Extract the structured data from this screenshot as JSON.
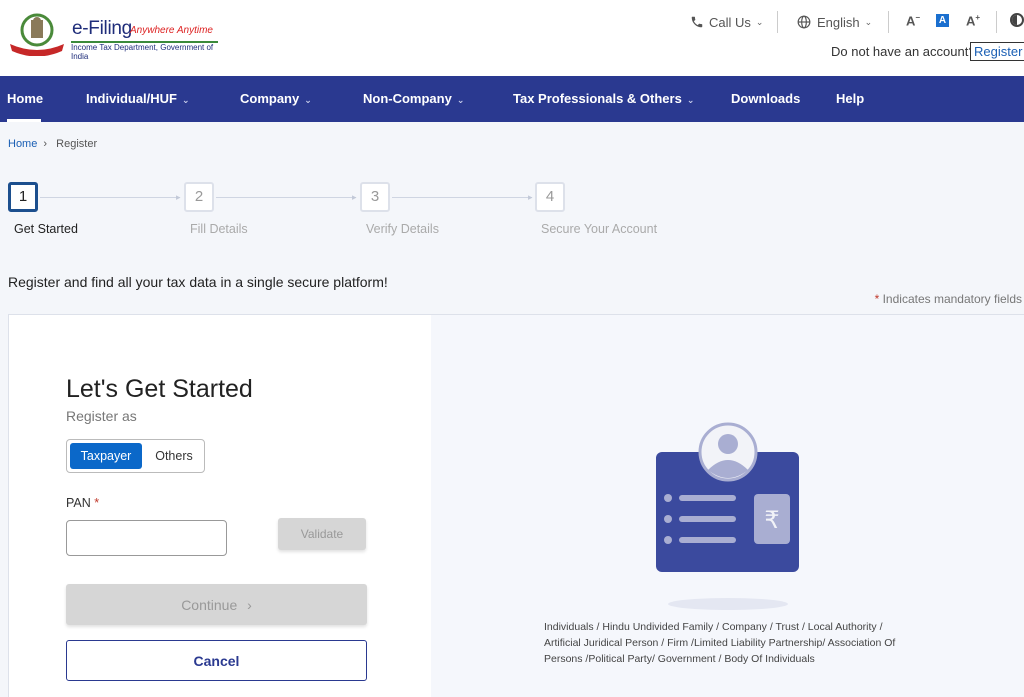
{
  "header": {
    "brand_title": "e-Filing",
    "brand_tagline": "Anywhere Anytime",
    "brand_subtitle": "Income Tax Department, Government of India",
    "call_us": "Call Us",
    "language": "English",
    "font_decrease": "A",
    "font_normal": "A",
    "font_increase": "A",
    "no_account_text": "Do not have an account?",
    "register_link": "Register"
  },
  "nav": {
    "items": [
      {
        "label": "Home",
        "has_dropdown": false
      },
      {
        "label": "Individual/HUF",
        "has_dropdown": true
      },
      {
        "label": "Company",
        "has_dropdown": true
      },
      {
        "label": "Non-Company",
        "has_dropdown": true
      },
      {
        "label": "Tax Professionals & Others",
        "has_dropdown": true
      },
      {
        "label": "Downloads",
        "has_dropdown": false
      },
      {
        "label": "Help",
        "has_dropdown": false
      }
    ],
    "active": "Home"
  },
  "breadcrumb": {
    "home": "Home",
    "separator": "›",
    "current": "Register"
  },
  "stepper": {
    "current_step": 1,
    "steps": [
      {
        "number": "1",
        "label": "Get Started"
      },
      {
        "number": "2",
        "label": "Fill Details"
      },
      {
        "number": "3",
        "label": "Verify Details"
      },
      {
        "number": "4",
        "label": "Secure Your Account"
      }
    ]
  },
  "main": {
    "tagline": "Register and find all your tax data in a single secure platform!",
    "mandatory_star": "*",
    "mandatory_note": "Indicates mandatory fields"
  },
  "form": {
    "title": "Let's Get Started",
    "register_as_label": "Register as",
    "register_as_options": [
      "Taxpayer",
      "Others"
    ],
    "register_as_selected": "Taxpayer",
    "pan_label": "PAN",
    "pan_required": "*",
    "pan_value": "",
    "pan_placeholder": "",
    "validate_button": "Validate",
    "continue_button": "Continue",
    "continue_chevron": "›",
    "cancel_button": "Cancel"
  },
  "illustration": {
    "icon": "id-card-rupee-icon",
    "currency_glyph": "₹",
    "description": "Individuals / Hindu Undivided Family / Company / Trust / Local Authority / Artificial Juridical Person / Firm /Limited Liability Partnership/ Association Of Persons /Political Party/ Government / Body Of Individuals"
  },
  "colors": {
    "nav_bg": "#2a3990",
    "primary": "#0b68c9",
    "active_step": "#1c4f8e",
    "illustration": "#3b4a9e",
    "required": "#c0392b"
  }
}
